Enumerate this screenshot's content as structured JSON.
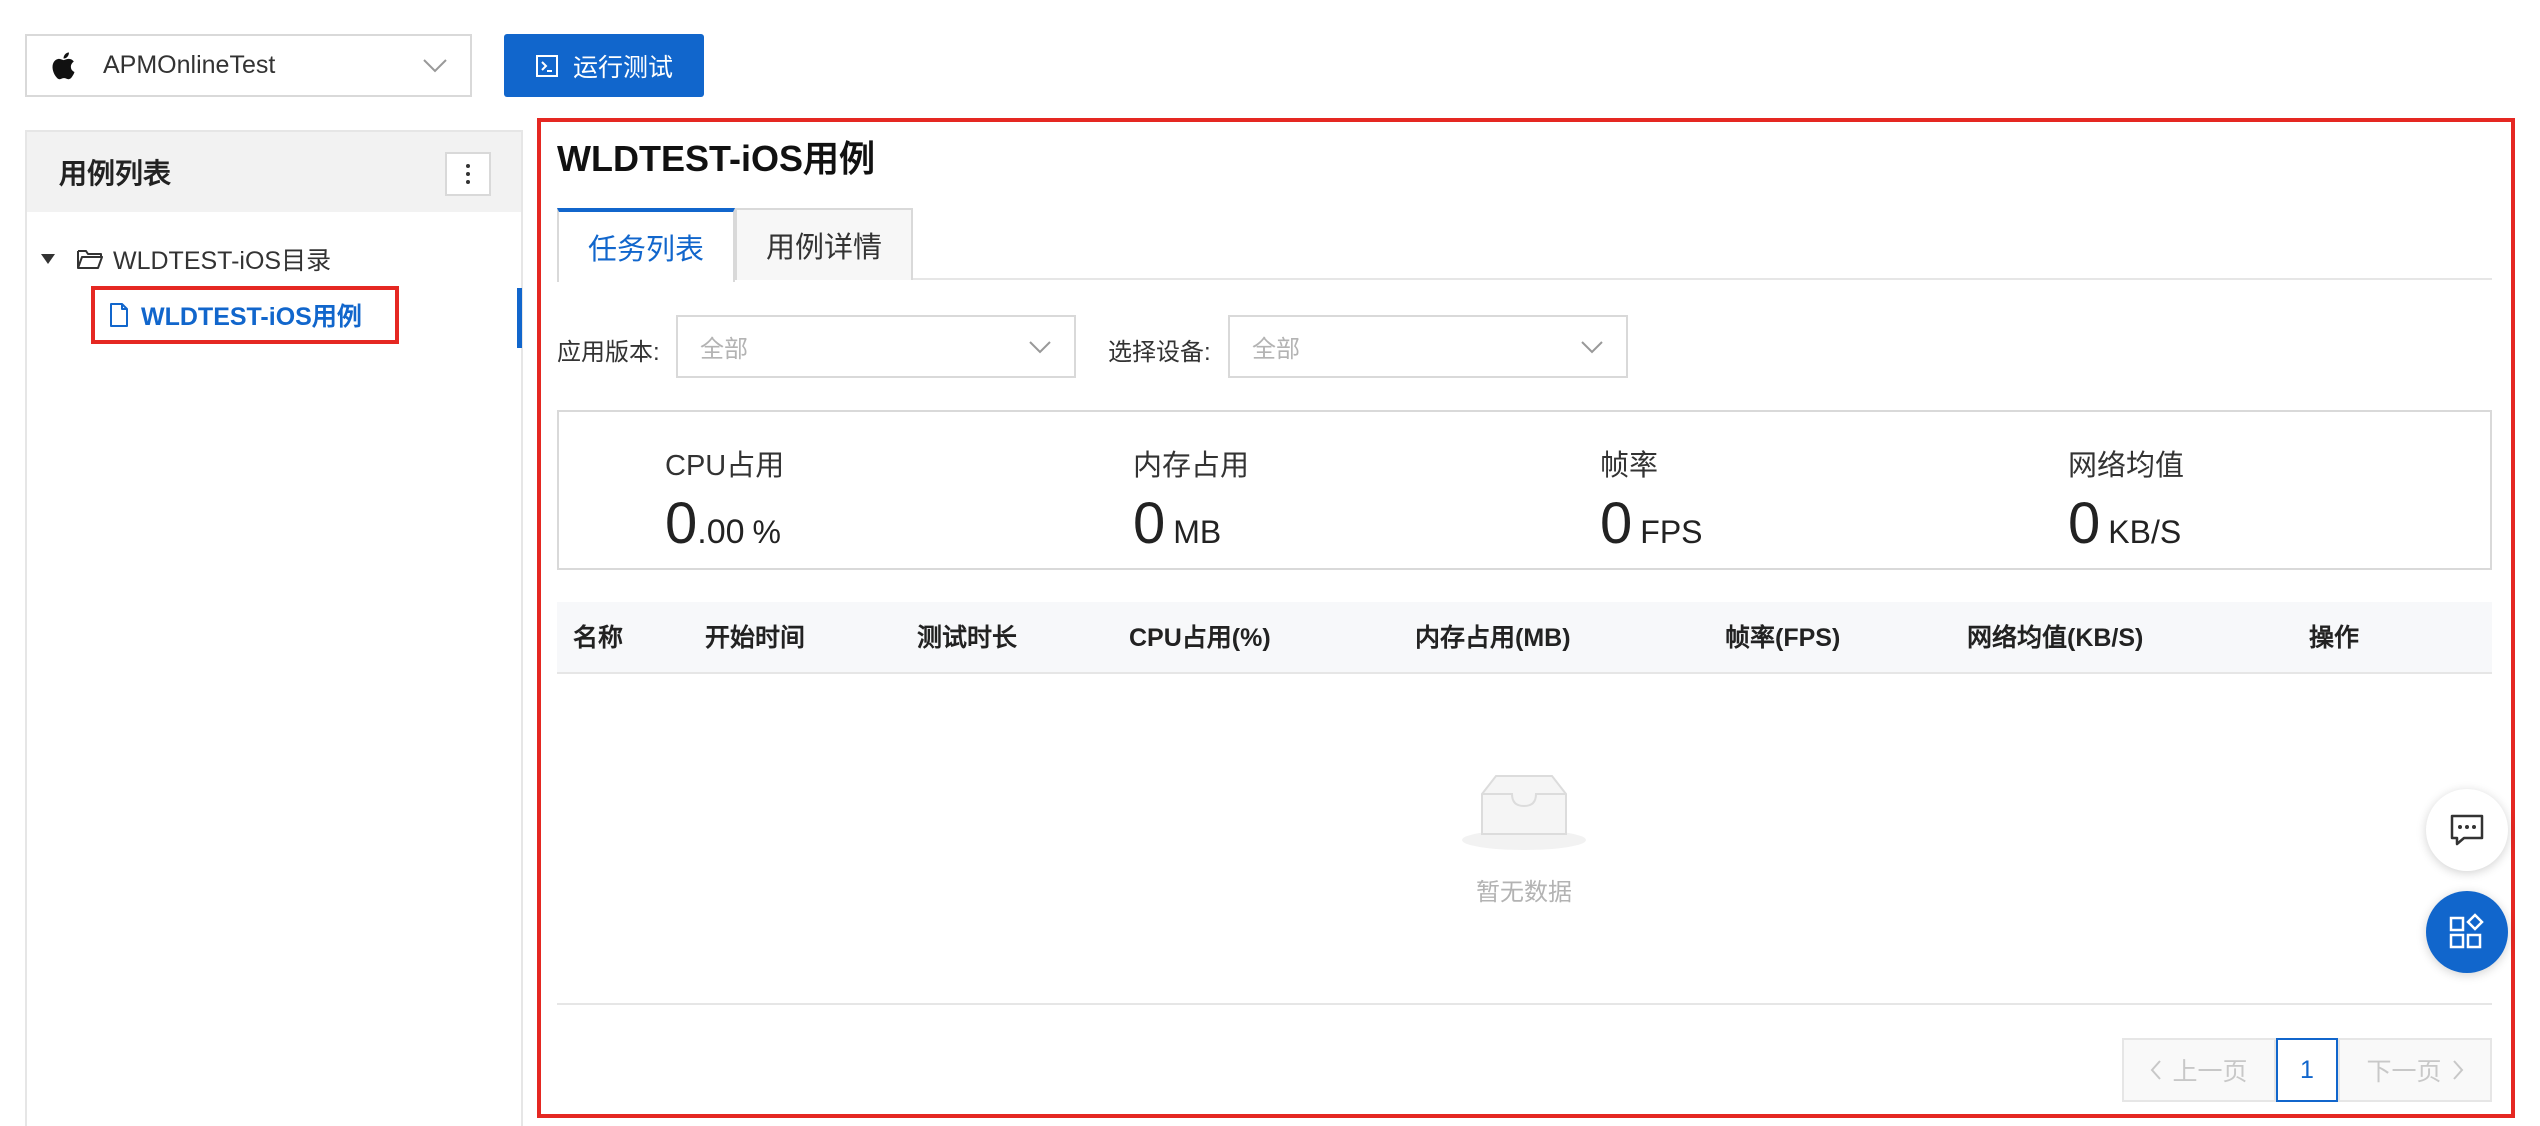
{
  "toolbar": {
    "app_select_value": "APMOnlineTest",
    "run_label": "运行测试"
  },
  "sidebar": {
    "title": "用例列表",
    "tree": {
      "folder_label": "WLDTEST-iOS目录",
      "case_label": "WLDTEST-iOS用例"
    }
  },
  "main": {
    "title": "WLDTEST-iOS用例",
    "tabs": [
      {
        "label": "任务列表",
        "active": true
      },
      {
        "label": "用例详情",
        "active": false
      }
    ],
    "filters": {
      "version_label": "应用版本:",
      "version_value": "全部",
      "device_label": "选择设备:",
      "device_value": "全部"
    },
    "stats": [
      {
        "label": "CPU占用",
        "value_int": "0",
        "value_frac": ".00",
        "unit": "%"
      },
      {
        "label": "内存占用",
        "value_int": "0",
        "value_frac": "",
        "unit": "MB"
      },
      {
        "label": "帧率",
        "value_int": "0",
        "value_frac": "",
        "unit": "FPS"
      },
      {
        "label": "网络均值",
        "value_int": "0",
        "value_frac": "",
        "unit": "KB/S"
      }
    ],
    "table": {
      "columns": [
        "名称",
        "开始时间",
        "测试时长",
        "CPU占用(%)",
        "内存占用(MB)",
        "帧率(FPS)",
        "网络均值(KB/S)",
        "操作"
      ],
      "empty_text": "暂无数据"
    },
    "pagination": {
      "prev_label": "上一页",
      "current_page": "1",
      "next_label": "下一页"
    }
  },
  "colors": {
    "primary": "#1166cc",
    "highlight_outline": "#e52822"
  },
  "icons": {
    "app_platform": "apple-icon",
    "run": "terminal-icon",
    "chat_fab": "chat-icon",
    "apps_fab": "apps-icon"
  }
}
